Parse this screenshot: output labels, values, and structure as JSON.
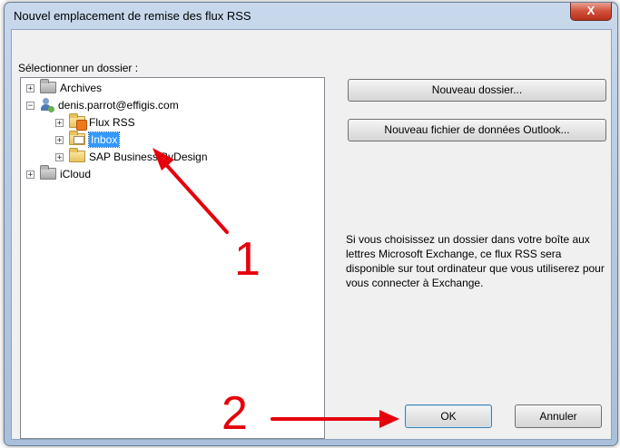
{
  "window": {
    "title": "Nouvel emplacement de remise des flux RSS",
    "close_label": "X"
  },
  "tree": {
    "label": "Sélectionner un dossier :",
    "items": [
      {
        "label": "Archives",
        "expander": "+"
      },
      {
        "label": "denis.parrot@effigis.com",
        "expander": "−"
      },
      {
        "label": "Flux RSS",
        "expander": "+"
      },
      {
        "label": "Inbox",
        "expander": "+",
        "selected": true
      },
      {
        "label": "SAP Business ByDesign",
        "expander": "+"
      },
      {
        "label": "iCloud",
        "expander": "+"
      }
    ]
  },
  "buttons": {
    "new_folder": "Nouveau dossier...",
    "new_pst": "Nouveau fichier de données Outlook...",
    "ok": "OK",
    "cancel": "Annuler"
  },
  "info": "Si vous choisissez un dossier dans votre boîte aux lettres Microsoft Exchange, ce flux RSS sera disponible sur tout ordinateur que vous utiliserez pour vous connecter à Exchange.",
  "annotations": {
    "step1": "1",
    "step2": "2",
    "arrow_color": "#e6000b"
  }
}
